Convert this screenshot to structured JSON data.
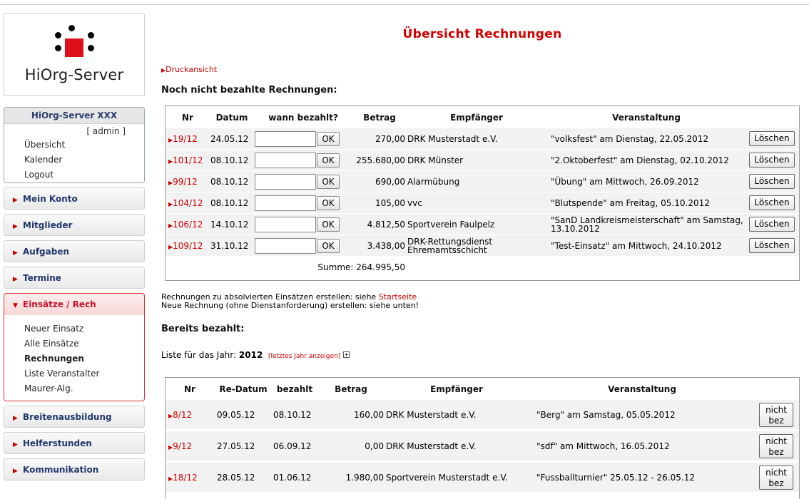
{
  "app": {
    "logo_text": "HiOrg-Server",
    "accent_color": "#d40000"
  },
  "userbox": {
    "title": "HiOrg-Server XXX",
    "role": "[ admin ]",
    "links": [
      "Übersicht",
      "Kalender",
      "Logout"
    ]
  },
  "nav": {
    "mein_konto": "Mein Konto",
    "mitglieder": "Mitglieder",
    "aufgaben": "Aufgaben",
    "termine": "Termine",
    "einsaetze": "Einsätze / Rech",
    "einsaetze_sub": [
      "Neuer Einsatz",
      "Alle Einsätze",
      "Rechnungen",
      "Liste Veranstalter",
      "Maurer-Alg."
    ],
    "breitenausbildung": "Breitenausbildung",
    "helferstunden": "Helferstunden",
    "kommunikation": "Kommunikation"
  },
  "page": {
    "title": "Übersicht Rechnungen",
    "druckansicht": "Druckansicht",
    "unpaid_heading": "Noch nicht bezahlte Rechnungen:",
    "paid_heading": "Bereits bezahlt:",
    "info1_text": "Rechnungen zu absolvierten Einsätzen erstellen: siehe ",
    "info1_link": "Startseite",
    "info2": "Neue Rechnung (ohne Dienstanforderung) erstellen: siehe unten!",
    "year_label": "Liste für das Jahr:",
    "year": "2012",
    "last_year_link": "[letztes Jahr anzeigen]",
    "plus_icon": "+"
  },
  "unpaid": {
    "headers": [
      "Nr",
      "Datum",
      "wann bezahlt?",
      "Betrag",
      "Empfänger",
      "Veranstaltung"
    ],
    "ok_label": "OK",
    "delete_label": "Löschen",
    "rows": [
      {
        "nr": "19/12",
        "datum": "24.05.12",
        "betrag": "270,00",
        "empf": "DRK Musterstadt e.V.",
        "veranst": "\"volksfest\" am Dienstag, 22.05.2012"
      },
      {
        "nr": "101/12",
        "datum": "08.10.12",
        "betrag": "255.680,00",
        "empf": "DRK Münster",
        "veranst": "\"2.Oktoberfest\" am Dienstag, 02.10.2012"
      },
      {
        "nr": "99/12",
        "datum": "08.10.12",
        "betrag": "690,00",
        "empf": "Alarmübung",
        "veranst": "\"Übung\" am Mittwoch, 26.09.2012"
      },
      {
        "nr": "104/12",
        "datum": "08.10.12",
        "betrag": "105,00",
        "empf": "vvc",
        "veranst": "\"Blutspende\" am Freitag, 05.10.2012"
      },
      {
        "nr": "106/12",
        "datum": "14.10.12",
        "betrag": "4.812,50",
        "empf": "Sportverein Faulpelz",
        "veranst": "\"SanD Landkreismeisterschaft\" am Samstag, 13.10.2012"
      },
      {
        "nr": "109/12",
        "datum": "31.10.12",
        "betrag": "3.438,00",
        "empf": "DRK-Rettungsdienst Ehremamtsschicht",
        "veranst": "\"Test-Einsatz\" am Mittwoch, 24.10.2012"
      }
    ],
    "sum_label": "Summe:",
    "sum_value": "264.995,50"
  },
  "paid": {
    "headers": [
      "Nr",
      "Re-Datum",
      "bezahlt",
      "Betrag",
      "Empfänger",
      "Veranstaltung"
    ],
    "nicht_bez_line1": "nicht",
    "nicht_bez_line2": "bez",
    "rows": [
      {
        "nr": "8/12",
        "redatum": "09.05.12",
        "bezahlt": "08.10.12",
        "betrag": "160,00",
        "empf": "DRK Musterstadt e.V.",
        "veranst": "\"Berg\" am Samstag, 05.05.2012"
      },
      {
        "nr": "9/12",
        "redatum": "27.05.12",
        "bezahlt": "06.09.12",
        "betrag": "0,00",
        "empf": "DRK Musterstadt e.V.",
        "veranst": "\"sdf\" am Mittwoch, 16.05.2012"
      },
      {
        "nr": "18/12",
        "redatum": "28.05.12",
        "bezahlt": "01.06.12",
        "betrag": "1.980,00",
        "empf": "Sportverein Musterstadt e.V.",
        "veranst": "\"Fussballturnier\" 25.05.12 - 26.05.12"
      }
    ]
  }
}
